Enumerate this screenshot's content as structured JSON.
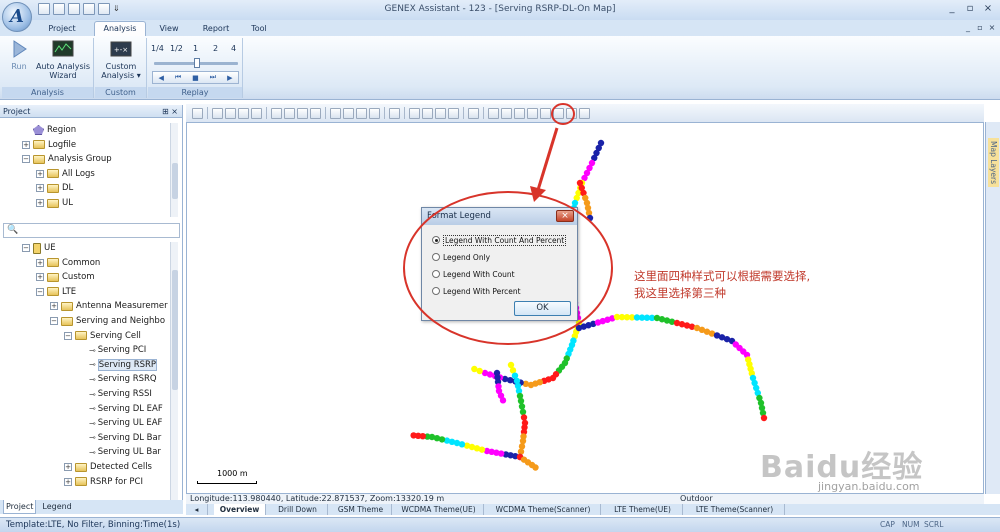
{
  "app": {
    "window_title": "GENEX Assistant - 123 - [Serving RSRP-DL-On Map]",
    "logo_letter": "A",
    "qat_more": "⇓",
    "help_icon": "?",
    "window_buttons": [
      "_",
      "▫",
      "×"
    ]
  },
  "ribbon": {
    "tabs": [
      {
        "label": "Project"
      },
      {
        "label": "Analysis"
      },
      {
        "label": "View"
      },
      {
        "label": "Report"
      },
      {
        "label": "Tool"
      }
    ],
    "groups": {
      "analysis": {
        "caption": "Analysis",
        "run": "Run",
        "wizard": "Auto Analysis Wizard"
      },
      "custom": {
        "caption": "Custom",
        "custom_analysis": "Custom Analysis ▾"
      },
      "replay": {
        "caption": "Replay",
        "rates": [
          "1/4",
          "1/2",
          "1",
          "2",
          "4"
        ],
        "controls": [
          "◀",
          "⏮",
          "■",
          "⏭",
          "▶"
        ]
      }
    }
  },
  "project_panel": {
    "title": "Project",
    "pin": "⊞ ×",
    "tree_top": [
      {
        "label": "Region",
        "expander": ""
      },
      {
        "label": "Logfile",
        "expander": "+"
      },
      {
        "label": "Analysis Group",
        "expander": "−"
      },
      {
        "label": "All Logs",
        "expander": "+"
      },
      {
        "label": "DL",
        "expander": "+"
      },
      {
        "label": "UL",
        "expander": "+"
      }
    ],
    "search_icon": "🔍",
    "tree_bottom": [
      {
        "label": "UE",
        "expander": "−"
      },
      {
        "label": "Common",
        "expander": "+"
      },
      {
        "label": "Custom",
        "expander": "+"
      },
      {
        "label": "LTE",
        "expander": "−"
      },
      {
        "label": "Antenna Measuremer",
        "expander": "+"
      },
      {
        "label": "Serving and Neighbo",
        "expander": "−"
      },
      {
        "label": "Serving Cell",
        "expander": "−"
      },
      {
        "label": "Serving PCI",
        "expander": ""
      },
      {
        "label": "Serving RSRP",
        "expander": ""
      },
      {
        "label": "Serving RSRQ",
        "expander": ""
      },
      {
        "label": "Serving RSSI",
        "expander": ""
      },
      {
        "label": "Serving DL EAF",
        "expander": ""
      },
      {
        "label": "Serving UL EAF",
        "expander": ""
      },
      {
        "label": "Serving DL Bar",
        "expander": ""
      },
      {
        "label": "Serving UL Bar",
        "expander": ""
      },
      {
        "label": "Detected Cells",
        "expander": "+"
      },
      {
        "label": "RSRP for PCI",
        "expander": "+"
      }
    ],
    "leaf_glyph": "⊸",
    "bottom_tabs": [
      "Project",
      "Legend"
    ]
  },
  "map": {
    "layers_label": "Map Layers",
    "scale_label": "1000 m",
    "coords": "Longitude:113.980440, Latitude:22.871537, Zoom:13320.19 m",
    "outdoor": "Outdoor",
    "theme_tabs": [
      "Overview",
      "Drill Down",
      "GSM Theme",
      "WCDMA Theme(UE)",
      "WCDMA Theme(Scanner)",
      "LTE Theme(UE)",
      "LTE Theme(Scanner)"
    ],
    "route_colors": [
      "#1a22a8",
      "#ff00ff",
      "#ffff00",
      "#00e5ff",
      "#1fc12a",
      "#ff1a1a",
      "#f59a1a"
    ]
  },
  "dialog": {
    "title": "Format Legend",
    "close": "×",
    "options": [
      {
        "label": "Legend With Count And Percent",
        "selected": true
      },
      {
        "label": "Legend Only",
        "selected": false
      },
      {
        "label": "Legend With Count",
        "selected": false
      },
      {
        "label": "Legend With Percent",
        "selected": false
      }
    ],
    "ok": "OK"
  },
  "annotation": {
    "line1": "这里面四种样式可以根据需要选择,",
    "line2": "我这里选择第三种",
    "color": "#c0392b"
  },
  "statusbar": {
    "text": "Template:LTE,  No Filter,  Binning:Time(1s)",
    "indicators": [
      "CAP",
      "NUM",
      "SCRL"
    ]
  },
  "watermark": {
    "text": "Baidu经验",
    "sub": "jingyan.baidu.com"
  }
}
